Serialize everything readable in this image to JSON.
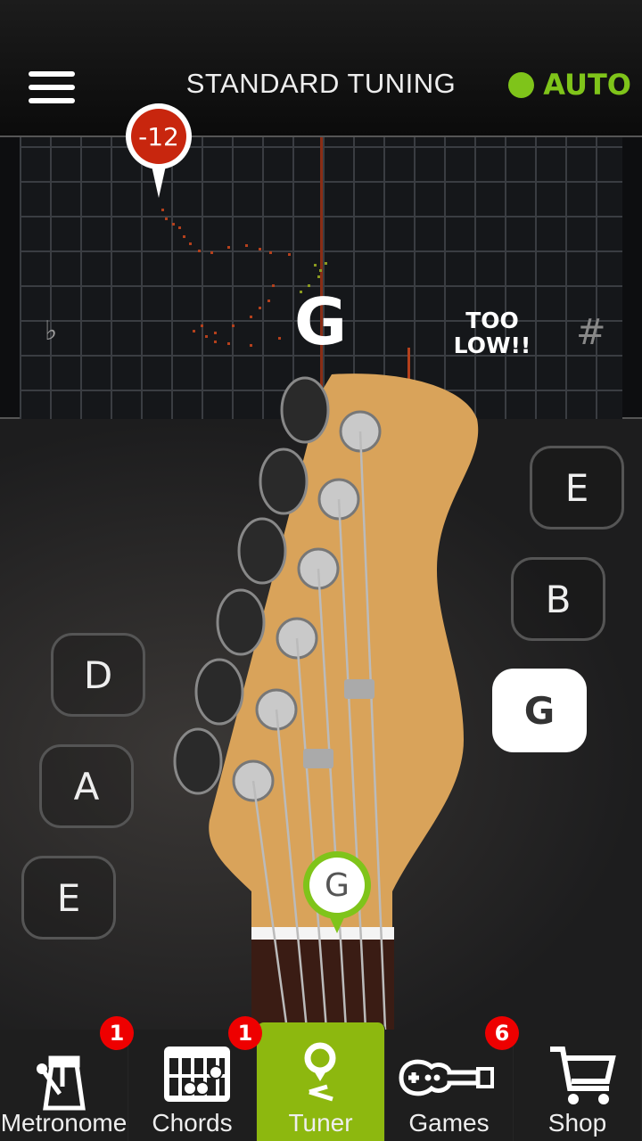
{
  "header": {
    "title": "STANDARD TUNING",
    "auto_label": "AUTO",
    "auto_color": "#7fc41a",
    "menu_icon": "hamburger-icon"
  },
  "graph": {
    "cents_offset": "-12",
    "detected_note": "G",
    "status": "TOO LOW!!",
    "flat_symbol": "♭",
    "sharp_symbol": "#"
  },
  "strings": {
    "left": [
      {
        "label": "D"
      },
      {
        "label": "A"
      },
      {
        "label": "E"
      }
    ],
    "right": [
      {
        "label": "E"
      },
      {
        "label": "B"
      },
      {
        "label": "G",
        "active": true
      }
    ],
    "selected": "G",
    "pin_label": "G"
  },
  "nav": {
    "tabs": [
      {
        "label": "Metronome",
        "icon": "metronome-icon",
        "badge": "1"
      },
      {
        "label": "Chords",
        "icon": "chord-grid-icon",
        "badge": "1"
      },
      {
        "label": "Tuner",
        "icon": "tuner-pin-icon",
        "active": true
      },
      {
        "label": "Games",
        "icon": "guitar-gamepad-icon",
        "badge": "6"
      },
      {
        "label": "Shop",
        "icon": "cart-icon"
      }
    ]
  },
  "colors": {
    "active_tab": "#8db80f",
    "badge": "#ee0000",
    "pitch_low": "#c8260e"
  }
}
